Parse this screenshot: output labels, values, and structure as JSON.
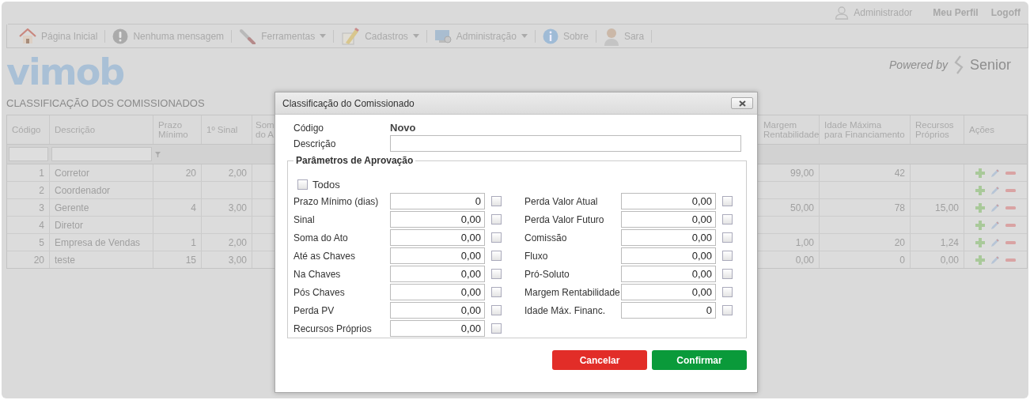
{
  "user_bar": {
    "user": "Administrador",
    "links": [
      "Meu Perfil",
      "Logoff"
    ]
  },
  "toolbar": [
    {
      "label": "Página Inicial",
      "kind": "home",
      "dropdown": false
    },
    {
      "label": "Nenhuma mensagem",
      "kind": "alert",
      "dropdown": false
    },
    {
      "label": "Ferramentas",
      "kind": "tools",
      "dropdown": true
    },
    {
      "label": "Cadastros",
      "kind": "register",
      "dropdown": true
    },
    {
      "label": "Administração",
      "kind": "admin",
      "dropdown": true
    },
    {
      "label": "Sobre",
      "kind": "info",
      "dropdown": false
    },
    {
      "label": "Sara",
      "kind": "avatar",
      "dropdown": false
    }
  ],
  "logo": "vimob",
  "powered_by": {
    "text": "Powered by",
    "brand": "Senior"
  },
  "page_title": "CLASSIFICAÇÃO DOS COMISSIONADOS",
  "table": {
    "columns_left": [
      "Código",
      "Descrição",
      "Prazo\nMínimo",
      "1º Sinal",
      "Som\ndo A"
    ],
    "columns_right": [
      "Margem\nRentabilidade",
      "Idade Máxima\npara Financiamento",
      "Recursos\nPróprios",
      "Ações"
    ],
    "rows": [
      {
        "codigo": "1",
        "descricao": "Corretor",
        "prazo_minimo": "20",
        "sinal_1": "2,00",
        "margem_rentabilidade": "99,00",
        "idade_maxima": "42"
      },
      {
        "codigo": "2",
        "descricao": "Coordenador"
      },
      {
        "codigo": "3",
        "descricao": "Gerente",
        "prazo_minimo": "4",
        "sinal_1": "3,00",
        "margem_rentabilidade": "50,00",
        "idade_maxima": "78",
        "recursos_proprios": "15,00"
      },
      {
        "codigo": "4",
        "descricao": "Diretor"
      },
      {
        "codigo": "5",
        "descricao": "Empresa de Vendas",
        "prazo_minimo": "1",
        "sinal_1": "2,00",
        "margem_rentabilidade": "1,00",
        "idade_maxima": "20",
        "recursos_proprios": "1,24"
      },
      {
        "codigo": "20",
        "descricao": "teste",
        "prazo_minimo": "15",
        "sinal_1": "3,00",
        "margem_rentabilidade": "0,00",
        "idade_maxima": "0",
        "recursos_proprios": "0,00"
      }
    ]
  },
  "modal": {
    "title": "Classificação do Comissionado",
    "code_label": "Código",
    "code_value": "Novo",
    "description_label": "Descrição",
    "section": "Parâmetros de Aprovação",
    "all": {
      "label": "Todos",
      "checked": false
    },
    "fields_left": [
      {
        "label": "Prazo Mínimo (dias)",
        "value": "0",
        "checked": false
      },
      {
        "label": "Sinal",
        "value": "0,00",
        "checked": false
      },
      {
        "label": "Soma do Ato",
        "value": "0,00",
        "checked": false
      },
      {
        "label": "Até as Chaves",
        "value": "0,00",
        "checked": false
      },
      {
        "label": "Na Chaves",
        "value": "0,00",
        "checked": false
      },
      {
        "label": "Pós Chaves",
        "value": "0,00",
        "checked": false
      },
      {
        "label": "Perda PV",
        "value": "0,00",
        "checked": false
      },
      {
        "label": "Recursos Próprios",
        "value": "0,00",
        "checked": false
      }
    ],
    "fields_right": [
      {
        "label": "Perda Valor Atual",
        "value": "0,00",
        "checked": false
      },
      {
        "label": "Perda Valor Futuro",
        "value": "0,00",
        "checked": false
      },
      {
        "label": "Comissão",
        "value": "0,00",
        "checked": false
      },
      {
        "label": "Fluxo",
        "value": "0,00",
        "checked": false
      },
      {
        "label": "Pró-Soluto",
        "value": "0,00",
        "checked": false
      },
      {
        "label": "Margem Rentabilidade",
        "value": "0,00",
        "checked": false
      },
      {
        "label": "Idade Máx. Financ.",
        "value": "0",
        "checked": false
      }
    ],
    "buttons": [
      "Cancelar",
      "Confirmar"
    ]
  }
}
